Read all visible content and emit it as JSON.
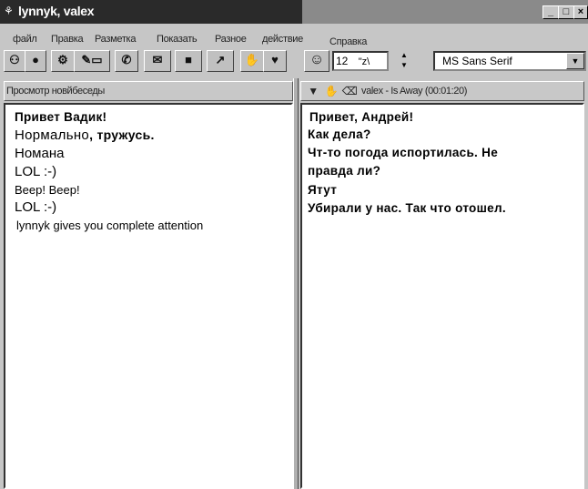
{
  "window": {
    "title": "lynnyk, valex",
    "minimize_glyph": "_",
    "maximize_glyph": "□",
    "close_glyph": "×"
  },
  "menu": {
    "items": [
      "файл",
      "Правка",
      "Разметка",
      "Показать",
      "Разное",
      "действие",
      "Справка"
    ]
  },
  "toolbar": {
    "font_size": "12",
    "font_size_suffix": "\"z\\",
    "font_name": "MS Sans Serif",
    "icons": [
      "connect-icon",
      "record-icon",
      "settings-icon",
      "edit-icon",
      "dial-icon",
      "mail-icon",
      "window-icon",
      "away-icon",
      "wave-icon",
      "heart-icon",
      "smiley-icon"
    ]
  },
  "left_pane": {
    "header": "Просмотр новйбеседы",
    "messages": [
      {
        "pre": "Привет Вадик!",
        "text": ""
      },
      {
        "pre": "Нормально",
        "text": ", тружусь."
      },
      {
        "pre": "Номана",
        "text": ""
      },
      {
        "pre": "LOL :-)",
        "text": ""
      },
      {
        "pre": "Beep! Beep!",
        "text": ""
      },
      {
        "pre": "LOL :-)",
        "text": ""
      },
      {
        "pre": "lynnyk gives you complete attention",
        "text": ""
      }
    ]
  },
  "right_pane": {
    "header": "valex - Is Away (00:01:20)",
    "messages": [
      "Привет, Андрей!",
      "Как дела?",
      "Чт-то погода испортилась. Не",
      "правда ли?",
      "Ятут",
      "Убирали у нас. Так что отошел."
    ]
  },
  "colors": {
    "title_active": "#2a2a2a",
    "title_inactive": "#8a8a8a",
    "chrome": "#c6c6c6",
    "pane_bg": "#ffffff"
  }
}
